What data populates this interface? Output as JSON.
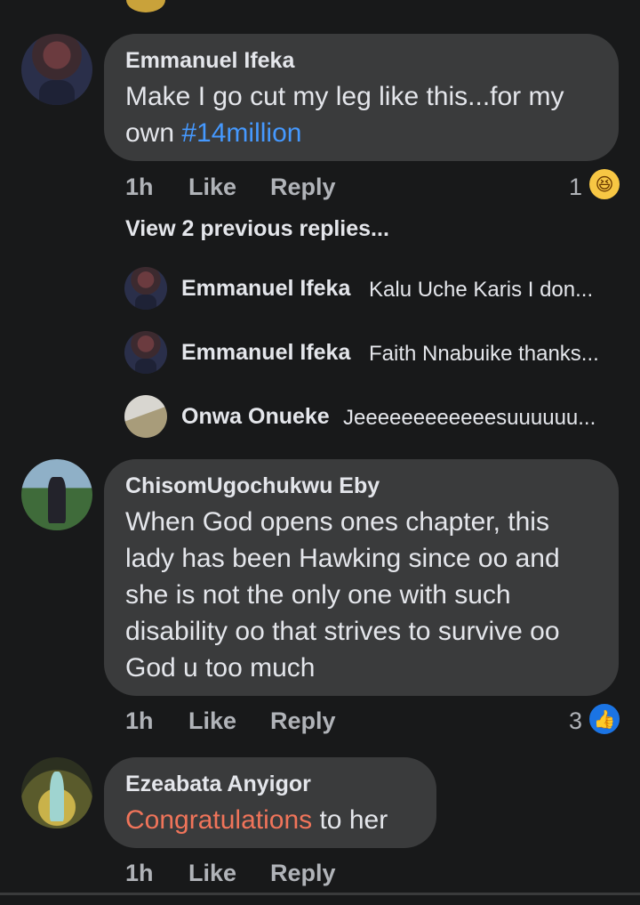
{
  "comments": [
    {
      "author": "Emmanuel Ifeka",
      "text_lines": [
        "Make I go cut my leg like this...for my",
        "own "
      ],
      "hashtag": "#14million",
      "time": "1h",
      "like_label": "Like",
      "reply_label": "Reply",
      "reaction_count": "1",
      "reaction_icon": "haha-icon",
      "view_previous": "View 2 previous replies...",
      "replies": [
        {
          "author": "Emmanuel Ifeka",
          "text": "Kalu Uche Karis I don..."
        },
        {
          "author": "Emmanuel Ifeka",
          "text": "Faith Nnabuike thanks..."
        },
        {
          "author": "Onwa Onueke",
          "text": "Jeeeeeeeeeeeesuuuuuu..."
        }
      ]
    },
    {
      "author": "ChisomUgochukwu Eby",
      "text_lines": [
        "When God opens ones chapter, this",
        "lady has been Hawking since oo and",
        "she is not the only one with such",
        "disability oo that strives to survive oo",
        "God u too much"
      ],
      "time": "1h",
      "like_label": "Like",
      "reply_label": "Reply",
      "reaction_count": "3",
      "reaction_icon": "like-icon"
    },
    {
      "author": "Ezeabata Anyigor",
      "highlight": "Congratulations",
      "text_rest": " to her",
      "time": "1h",
      "like_label": "Like",
      "reply_label": "Reply"
    }
  ],
  "colors": {
    "background": "#18191a",
    "bubble": "#3a3b3c",
    "hashtag": "#4599ff",
    "highlight": "#f0745a",
    "secondary_text": "#b0b3b8"
  }
}
